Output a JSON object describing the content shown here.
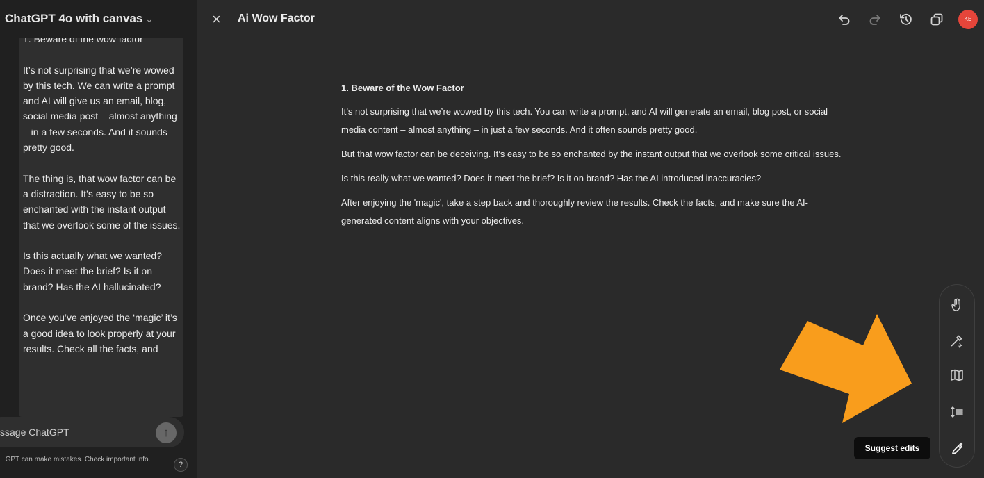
{
  "chat": {
    "title": "ChatGPT 4o with canvas",
    "chevron": "⌄",
    "paragraphs": [
      "1. Beware of the wow factor",
      "It’s not surprising that we’re wowed by this tech. We can write a prompt and AI will give us an email, blog, social media post – almost anything – in a few seconds. And it sounds pretty good.",
      "The thing is, that wow factor can be a distraction. It’s easy to be so enchanted with the instant output that we overlook some of the issues.",
      "Is this actually what we wanted? Does it meet the brief? Is it on brand? Has the AI hallucinated?",
      "Once you’ve enjoyed the ‘magic’ it’s a good idea to look properly at your results. Check all the facts, and"
    ],
    "composer_placeholder": "ssage ChatGPT",
    "disclaimer": "GPT can make mistakes. Check important info.",
    "help": "?"
  },
  "canvas": {
    "close": "×",
    "title": "Ai Wow Factor",
    "avatar_initials": "KE",
    "avatar_color": "#e5453a",
    "header_icons": [
      "undo-icon",
      "redo-icon",
      "history-icon",
      "copy-icon"
    ],
    "document": {
      "heading": "1. Beware of the Wow Factor",
      "paragraphs": [
        "It’s not surprising that we’re wowed by this tech. You can write a prompt, and AI will generate an email, blog post, or social media content – almost anything – in just a few seconds. And it often sounds pretty good.",
        "But that wow factor can be deceiving. It’s easy to be so enchanted by the instant output that we overlook some critical issues.",
        "Is this really what we wanted? Does it meet the brief? Is it on brand? Has the AI introduced inaccuracies?",
        "After enjoying the 'magic', take a step back and thoroughly review the results. Check the facts, and make sure the AI-generated content aligns with your objectives."
      ]
    }
  },
  "toolbar": {
    "items": [
      "emoji-icon",
      "polish-icon",
      "reading-level-icon",
      "adjust-length-icon",
      "suggest-edits-icon"
    ],
    "tooltip": "Suggest edits"
  },
  "annotation": {
    "arrow_color": "#f99d1c"
  }
}
